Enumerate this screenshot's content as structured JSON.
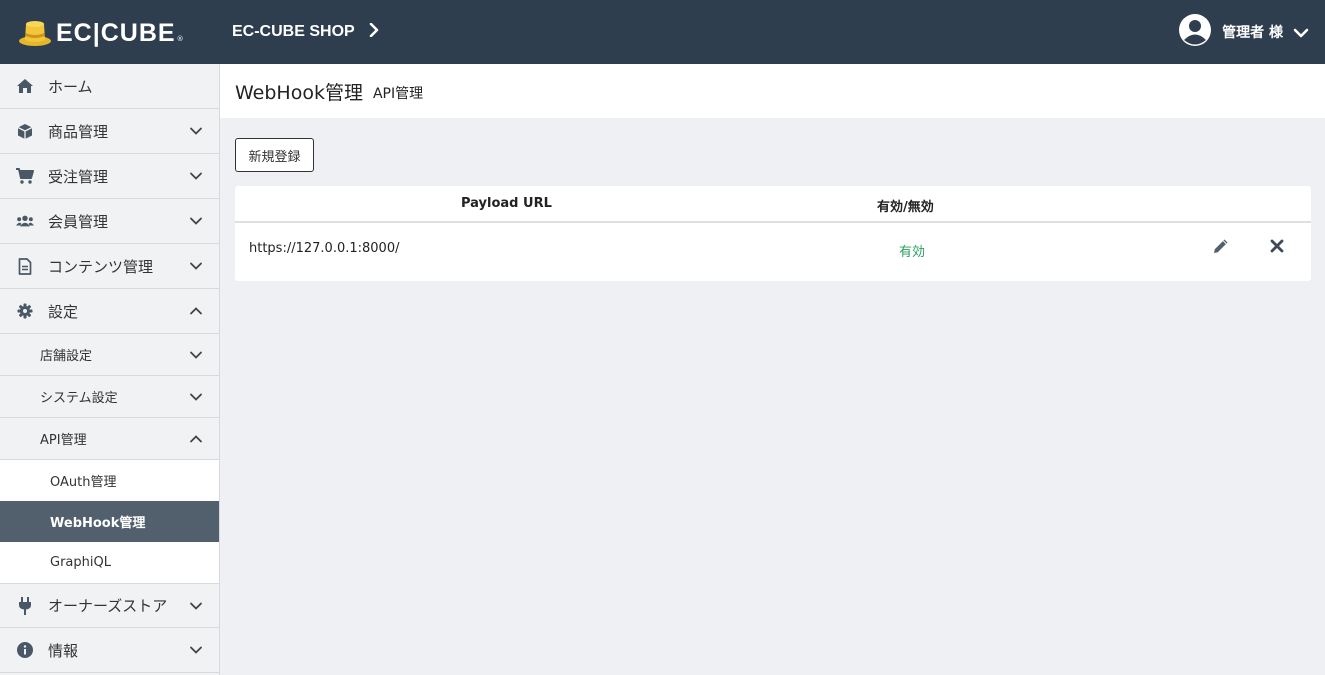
{
  "header": {
    "logo_text": "EC|CUBE",
    "logo_reg": "®",
    "shop_name": "EC-CUBE SHOP",
    "user_name": "管理者 様"
  },
  "sidebar": {
    "items": [
      {
        "label": "ホーム",
        "icon": "home-icon"
      },
      {
        "label": "商品管理",
        "icon": "cube-icon"
      },
      {
        "label": "受注管理",
        "icon": "cart-icon"
      },
      {
        "label": "会員管理",
        "icon": "users-icon"
      },
      {
        "label": "コンテンツ管理",
        "icon": "document-icon"
      },
      {
        "label": "設定",
        "icon": "gear-icon"
      },
      {
        "label": "オーナーズストア",
        "icon": "plug-icon"
      },
      {
        "label": "情報",
        "icon": "info-icon"
      }
    ],
    "settings_sub": [
      {
        "label": "店舗設定"
      },
      {
        "label": "システム設定"
      },
      {
        "label": "API管理"
      }
    ],
    "api_sub": [
      {
        "label": "OAuth管理"
      },
      {
        "label": "WebHook管理"
      },
      {
        "label": "GraphiQL"
      }
    ]
  },
  "page": {
    "title": "WebHook管理",
    "subtitle": "API管理"
  },
  "toolbar": {
    "new_label": "新規登録"
  },
  "table": {
    "headers": {
      "url": "Payload URL",
      "status": "有効/無効"
    },
    "rows": [
      {
        "url": "https://127.0.0.1:8000/",
        "status": "有効"
      }
    ]
  },
  "colors": {
    "header_bg": "#2f3e4e",
    "active_nav_bg": "#525f6d",
    "status_active": "#27a05e",
    "logo_gold": "#e5b62a"
  }
}
